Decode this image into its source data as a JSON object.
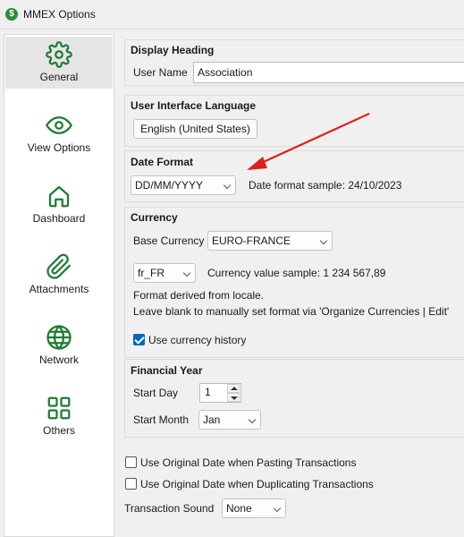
{
  "window": {
    "title": "MMEX Options",
    "app_icon_glyph": "$"
  },
  "sidebar": {
    "items": [
      {
        "label": "General",
        "icon": "gear-icon",
        "active": true
      },
      {
        "label": "View Options",
        "icon": "eye-icon"
      },
      {
        "label": "Dashboard",
        "icon": "home-icon"
      },
      {
        "label": "Attachments",
        "icon": "paperclip-icon"
      },
      {
        "label": "Network",
        "icon": "globe-icon"
      },
      {
        "label": "Others",
        "icon": "grid-icon"
      }
    ],
    "icon_color": "#1e7b34"
  },
  "display_heading": {
    "title": "Display Heading",
    "user_name_label": "User Name",
    "user_name_value": "Association"
  },
  "ui_language": {
    "title": "User Interface Language",
    "button": "English (United States)"
  },
  "date_format": {
    "title": "Date Format",
    "selected": "DD/MM/YYYY",
    "sample": "Date format sample: 24/10/2023"
  },
  "currency": {
    "title": "Currency",
    "base_label": "Base Currency",
    "base_value": "EURO-FRANCE",
    "locale_value": "fr_FR",
    "value_sample": "Currency value sample: 1 234 567,89",
    "note_line1": "Format derived from locale.",
    "note_line2": "Leave blank to manually set format via 'Organize Currencies | Edit'",
    "history_label": "Use currency history",
    "history_checked": true
  },
  "financial_year": {
    "title": "Financial Year",
    "start_day_label": "Start Day",
    "start_day_value": "1",
    "start_month_label": "Start Month",
    "start_month_value": "Jan"
  },
  "options": {
    "pasting_label": "Use Original Date when Pasting Transactions",
    "duplicating_label": "Use Original Date when Duplicating Transactions",
    "sound_label": "Transaction Sound",
    "sound_value": "None"
  },
  "annotation": {
    "arrow_color": "#e0201b"
  }
}
